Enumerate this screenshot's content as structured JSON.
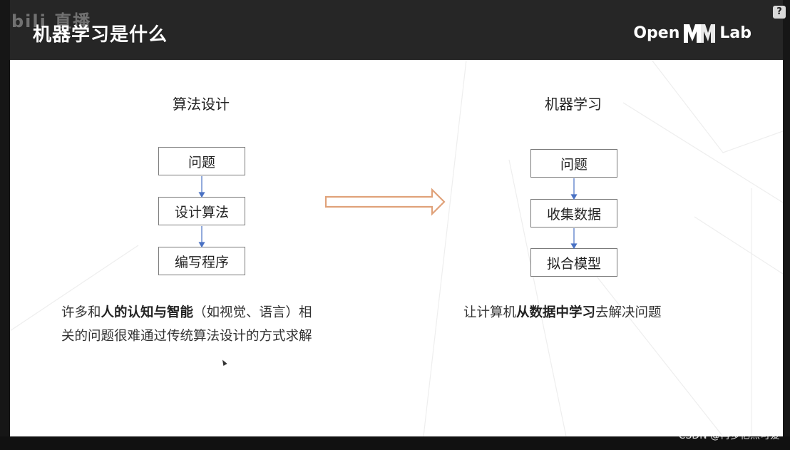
{
  "header": {
    "title": "机器学习是什么",
    "watermark": "bili 直播",
    "logo_left": "Open",
    "logo_right": "Lab",
    "help": "?"
  },
  "left": {
    "title": "算法设计",
    "steps": [
      "问题",
      "设计算法",
      "编写程序"
    ],
    "caption": {
      "line1_a": "许多和",
      "line1_b": "人的认知与智能",
      "line1_c": "（如视觉、语言）相",
      "line2": "关的问题很难通过传统算法设计的方式求解"
    }
  },
  "right": {
    "title": "机器学习",
    "steps": [
      "问题",
      "收集数据",
      "拟合模型"
    ],
    "caption": {
      "a": "让计算机",
      "b": "从数据中学习",
      "c": "去解决问题"
    }
  },
  "footer": {
    "credit": "CSDN @再多亿点可爱"
  },
  "colors": {
    "header_bg": "#262626",
    "arrow_outline": "#e0a27a",
    "connector": "#4a72c4"
  }
}
